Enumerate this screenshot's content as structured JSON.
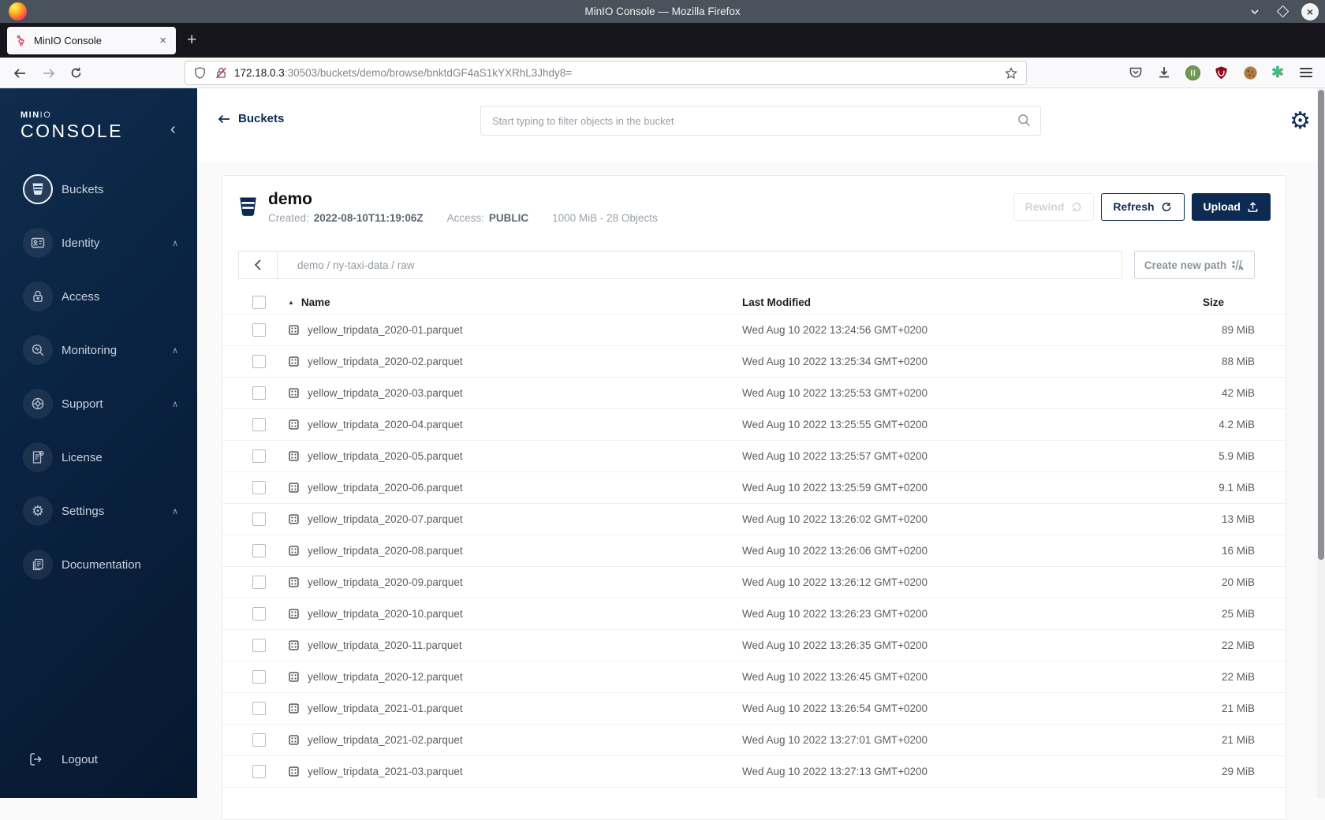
{
  "colors": {
    "accent_navy": "#0c2a52",
    "sidebar_top": "#0f2c4e",
    "sidebar_bottom": "#071830",
    "titlebar": "#4a535c",
    "ublock_red": "#8a0f1c"
  },
  "window": {
    "title": "MinIO Console — Mozilla Firefox"
  },
  "browser": {
    "tab_title": "MinIO Console",
    "tab_close": "×",
    "new_tab_button": "+",
    "url_host": "172.18.0.3",
    "url_rest": ":30503/buckets/demo/browse/bnktdGF4aS1kYXRhL3Jhdy8="
  },
  "sidebar": {
    "logo": {
      "brand_bold": "MIN",
      "brand_light": "IO",
      "product": "CONSOLE"
    },
    "items": [
      {
        "label": "Buckets",
        "selected": true,
        "expandable": false
      },
      {
        "label": "Identity",
        "selected": false,
        "expandable": true
      },
      {
        "label": "Access",
        "selected": false,
        "expandable": false
      },
      {
        "label": "Monitoring",
        "selected": false,
        "expandable": true
      },
      {
        "label": "Support",
        "selected": false,
        "expandable": true
      },
      {
        "label": "License",
        "selected": false,
        "expandable": false
      },
      {
        "label": "Settings",
        "selected": false,
        "expandable": true
      },
      {
        "label": "Documentation",
        "selected": false,
        "expandable": false
      }
    ],
    "logout_label": "Logout"
  },
  "header": {
    "back_label": "Buckets",
    "search_placeholder": "Start typing to filter objects in the bucket"
  },
  "bucket": {
    "name": "demo",
    "created_label": "Created:",
    "created_value": "2022-08-10T11:19:06Z",
    "access_label": "Access:",
    "access_value": "PUBLIC",
    "usage": "1000 MiB - 28 Objects",
    "actions": {
      "rewind": "Rewind",
      "refresh": "Refresh",
      "upload": "Upload"
    }
  },
  "path_bar": {
    "breadcrumb": "demo / ny-taxi-data / raw",
    "create_path_label": "Create new path"
  },
  "objects_table": {
    "headers": {
      "name": "Name",
      "last_modified": "Last Modified",
      "size": "Size"
    },
    "rows": [
      {
        "name": "yellow_tripdata_2020-01.parquet",
        "modified": "Wed Aug 10 2022 13:24:56 GMT+0200",
        "size": "89 MiB"
      },
      {
        "name": "yellow_tripdata_2020-02.parquet",
        "modified": "Wed Aug 10 2022 13:25:34 GMT+0200",
        "size": "88 MiB"
      },
      {
        "name": "yellow_tripdata_2020-03.parquet",
        "modified": "Wed Aug 10 2022 13:25:53 GMT+0200",
        "size": "42 MiB"
      },
      {
        "name": "yellow_tripdata_2020-04.parquet",
        "modified": "Wed Aug 10 2022 13:25:55 GMT+0200",
        "size": "4.2 MiB"
      },
      {
        "name": "yellow_tripdata_2020-05.parquet",
        "modified": "Wed Aug 10 2022 13:25:57 GMT+0200",
        "size": "5.9 MiB"
      },
      {
        "name": "yellow_tripdata_2020-06.parquet",
        "modified": "Wed Aug 10 2022 13:25:59 GMT+0200",
        "size": "9.1 MiB"
      },
      {
        "name": "yellow_tripdata_2020-07.parquet",
        "modified": "Wed Aug 10 2022 13:26:02 GMT+0200",
        "size": "13 MiB"
      },
      {
        "name": "yellow_tripdata_2020-08.parquet",
        "modified": "Wed Aug 10 2022 13:26:06 GMT+0200",
        "size": "16 MiB"
      },
      {
        "name": "yellow_tripdata_2020-09.parquet",
        "modified": "Wed Aug 10 2022 13:26:12 GMT+0200",
        "size": "20 MiB"
      },
      {
        "name": "yellow_tripdata_2020-10.parquet",
        "modified": "Wed Aug 10 2022 13:26:23 GMT+0200",
        "size": "25 MiB"
      },
      {
        "name": "yellow_tripdata_2020-11.parquet",
        "modified": "Wed Aug 10 2022 13:26:35 GMT+0200",
        "size": "22 MiB"
      },
      {
        "name": "yellow_tripdata_2020-12.parquet",
        "modified": "Wed Aug 10 2022 13:26:45 GMT+0200",
        "size": "22 MiB"
      },
      {
        "name": "yellow_tripdata_2021-01.parquet",
        "modified": "Wed Aug 10 2022 13:26:54 GMT+0200",
        "size": "21 MiB"
      },
      {
        "name": "yellow_tripdata_2021-02.parquet",
        "modified": "Wed Aug 10 2022 13:27:01 GMT+0200",
        "size": "21 MiB"
      },
      {
        "name": "yellow_tripdata_2021-03.parquet",
        "modified": "Wed Aug 10 2022 13:27:13 GMT+0200",
        "size": "29 MiB"
      }
    ]
  }
}
